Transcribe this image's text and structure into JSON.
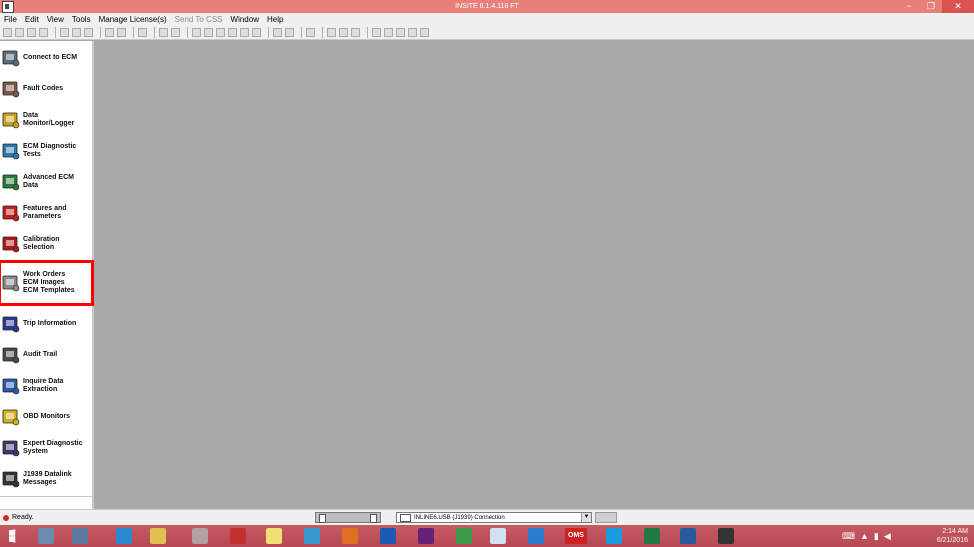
{
  "window": {
    "title": "INSITE 8.1.4.118 FT",
    "minimize": "−",
    "restore": "❐",
    "close": "✕"
  },
  "menu": [
    {
      "label": "File",
      "enabled": true
    },
    {
      "label": "Edit",
      "enabled": true
    },
    {
      "label": "View",
      "enabled": true
    },
    {
      "label": "Tools",
      "enabled": true
    },
    {
      "label": "Manage License(s)",
      "enabled": true
    },
    {
      "label": "Send To CSS",
      "enabled": false
    },
    {
      "label": "Window",
      "enabled": true
    },
    {
      "label": "Help",
      "enabled": true
    }
  ],
  "sidebar": {
    "items": [
      {
        "line1": "Connect to ECM",
        "line2": "",
        "line3": "",
        "icon": "connect-ecm-icon",
        "color": "#5a6a7a"
      },
      {
        "line1": "Fault Codes",
        "line2": "",
        "line3": "",
        "icon": "fault-codes-icon",
        "color": "#7a5a4a"
      },
      {
        "line1": "Data",
        "line2": "Monitor/Logger",
        "line3": "",
        "icon": "data-monitor-icon",
        "color": "#c8a020"
      },
      {
        "line1": "ECM Diagnostic",
        "line2": "Tests",
        "line3": "",
        "icon": "ecm-diagnostic-icon",
        "color": "#2a7ab0"
      },
      {
        "line1": "Advanced ECM",
        "line2": "Data",
        "line3": "",
        "icon": "advanced-ecm-icon",
        "color": "#2a7a3a"
      },
      {
        "line1": "Features and",
        "line2": "Parameters",
        "line3": "",
        "icon": "features-parameters-icon",
        "color": "#c02020"
      },
      {
        "line1": "Calibration",
        "line2": "Selection",
        "line3": "",
        "icon": "calibration-icon",
        "color": "#b01818"
      },
      {
        "line1": "Work Orders",
        "line2": "ECM Images",
        "line3": "ECM Templates",
        "icon": "work-orders-icon",
        "color": "#8a8a8a"
      },
      {
        "line1": "Trip Information",
        "line2": "",
        "line3": "",
        "icon": "trip-info-icon",
        "color": "#2a3a8a"
      },
      {
        "line1": "Audit Trail",
        "line2": "",
        "line3": "",
        "icon": "audit-trail-icon",
        "color": "#4a4a4a"
      },
      {
        "line1": "Inquire Data",
        "line2": "Extraction",
        "line3": "",
        "icon": "inquire-data-icon",
        "color": "#2a5aa0"
      },
      {
        "line1": "OBD Monitors",
        "line2": "",
        "line3": "",
        "icon": "obd-monitors-icon",
        "color": "#d0b020"
      },
      {
        "line1": "Expert Diagnostic",
        "line2": "System",
        "line3": "",
        "icon": "expert-diagnostic-icon",
        "color": "#3a3a6a"
      },
      {
        "line1": "J1939 Datalink",
        "line2": "Messages",
        "line3": "",
        "icon": "j1939-icon",
        "color": "#333333"
      }
    ],
    "highlighted_item": "Work Orders"
  },
  "status": {
    "text": "Ready.",
    "connection": "INLINE6.USB (J1939) Connection"
  },
  "taskbar": {
    "apps": [
      {
        "icon": "windows-start-icon",
        "color": "#ffffff"
      },
      {
        "icon": "explorer-app-icon",
        "color": "#6a8ab0"
      },
      {
        "icon": "calculator-app-icon",
        "color": "#5a7aa0"
      },
      {
        "icon": "ie-app-icon",
        "color": "#2a8ad0"
      },
      {
        "icon": "folder-app-icon",
        "color": "#e0c050"
      },
      {
        "icon": "insite-app-icon",
        "color": "#b0a0a0"
      },
      {
        "icon": "grid-app-icon",
        "color": "#c03030"
      },
      {
        "icon": "notes-app-icon",
        "color": "#f0e070"
      },
      {
        "icon": "globe-app-icon",
        "color": "#3a9ad0"
      },
      {
        "icon": "firefox-app-icon",
        "color": "#e07020"
      },
      {
        "icon": "outlook-app-icon",
        "color": "#1a5ab0"
      },
      {
        "icon": "visual-studio-app-icon",
        "color": "#68217a"
      },
      {
        "icon": "chrome-app-icon",
        "color": "#3a9a4a"
      },
      {
        "icon": "window-app-icon",
        "color": "#d0e0f0"
      },
      {
        "icon": "plus-app-icon",
        "color": "#2a7ad0"
      },
      {
        "icon": "oms-app-icon",
        "color": "#d02020"
      },
      {
        "icon": "skype-app-icon",
        "color": "#1a9ae0"
      },
      {
        "icon": "excel-app-icon",
        "color": "#1e7a3e"
      },
      {
        "icon": "word-app-icon",
        "color": "#2a5aa0"
      },
      {
        "icon": "cmd-app-icon",
        "color": "#333333"
      }
    ],
    "oms_label": "OMS",
    "time": "2:14 AM",
    "date": "6/21/2016"
  }
}
